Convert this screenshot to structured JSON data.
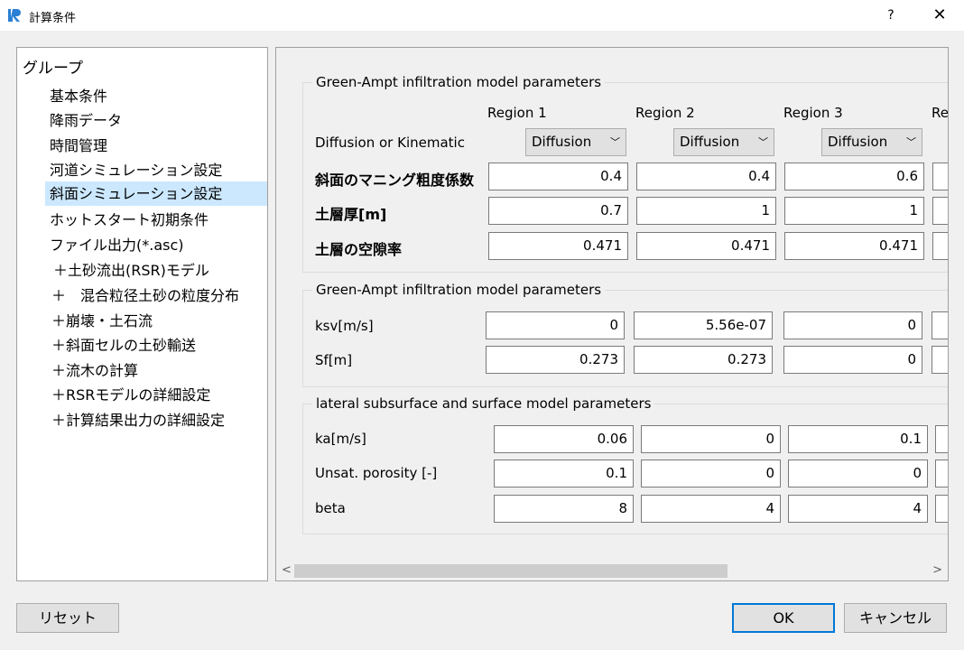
{
  "window": {
    "title": "計算条件",
    "help_label": "?",
    "close_label": "✕"
  },
  "tree": {
    "root_label": "グループ",
    "items": [
      "基本条件",
      "降雨データ",
      "時間管理",
      "河道シミュレーション設定",
      "斜面シミュレーション設定",
      "ホットスタート初期条件",
      "ファイル出力(*.asc)",
      "＋土砂流出(RSR)モデル",
      "＋　混合粒径土砂の粒度分布",
      "＋崩壊・土石流",
      "＋斜面セルの土砂輸送",
      "＋流木の計算",
      "＋RSRモデルの詳細設定",
      "＋計算結果出力の詳細設定"
    ],
    "selected_index": 4
  },
  "main": {
    "region_headers": [
      "Region 1",
      "Region 2",
      "Region 3",
      "Re"
    ],
    "group1": {
      "title": "Green-Ampt infiltration model parameters",
      "diffusion_label": "Diffusion or Kinematic",
      "diffusion_values": [
        "Diffusion",
        "Diffusion",
        "Diffusion"
      ],
      "rows": [
        {
          "label": "斜面のマニング粗度係数",
          "values": [
            "0.4",
            "0.4",
            "0.6"
          ]
        },
        {
          "label": "土層厚[m]",
          "values": [
            "0.7",
            "1",
            "1"
          ]
        },
        {
          "label": "土層の空隙率",
          "values": [
            "0.471",
            "0.471",
            "0.471"
          ]
        }
      ]
    },
    "group2": {
      "title": "Green-Ampt infiltration model parameters",
      "rows": [
        {
          "label": "ksv[m/s]",
          "values": [
            "0",
            "5.56e-07",
            "0"
          ]
        },
        {
          "label": "Sf[m]",
          "values": [
            "0.273",
            "0.273",
            "0"
          ]
        }
      ]
    },
    "group3": {
      "title": "lateral subsurface and surface model parameters",
      "rows": [
        {
          "label": "ka[m/s]",
          "values": [
            "0.06",
            "0",
            "0.1"
          ]
        },
        {
          "label": "Unsat. porosity [-]",
          "values": [
            "0.1",
            "0",
            "0"
          ]
        },
        {
          "label": "beta",
          "values": [
            "8",
            "4",
            "4"
          ]
        }
      ]
    }
  },
  "buttons": {
    "reset": "リセット",
    "ok": "OK",
    "cancel": "キャンセル"
  },
  "colors": {
    "selection": "#cce8ff",
    "default_button_border": "#0078d7"
  }
}
